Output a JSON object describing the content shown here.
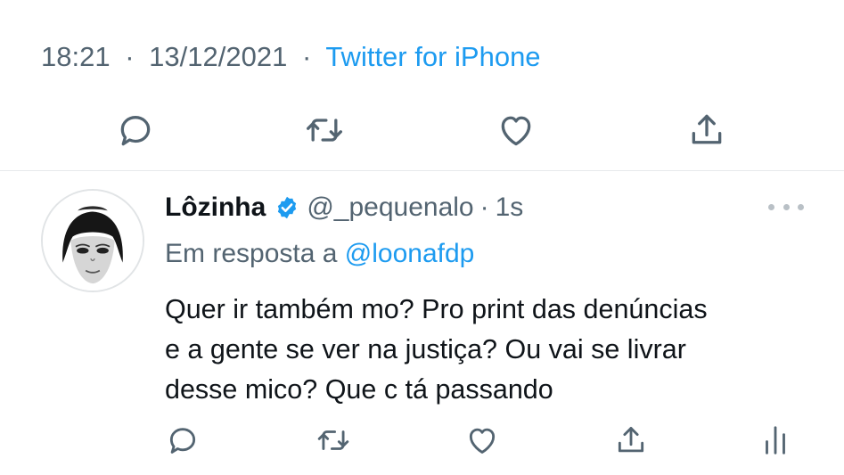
{
  "tweet": {
    "time": "18:21",
    "date": "13/12/2021",
    "source": "Twitter for iPhone",
    "separator": "·"
  },
  "main_actions": {
    "icons": [
      "reply-icon",
      "retweet-icon",
      "like-icon",
      "share-icon"
    ]
  },
  "reply": {
    "display_name": "Lôzinha",
    "handle": "@_pequenalo",
    "separator": "·",
    "time": "1s",
    "reply_prefix": "Em resposta a",
    "reply_to": "@loonafdp",
    "body_lines": [
      "Quer ir também mo? Pro print das denúncias",
      "e a gente se ver na justiça? Ou vai se livrar",
      "desse mico? Que c tá passando"
    ],
    "icons": [
      "reply-icon",
      "retweet-icon",
      "like-icon",
      "share-icon",
      "analytics-icon",
      "more-icon",
      "verified-badge-icon"
    ]
  },
  "colors": {
    "text_primary": "#0f1419",
    "text_secondary": "#536471",
    "accent": "#1d9bf0",
    "divider": "#e6e9eb"
  }
}
